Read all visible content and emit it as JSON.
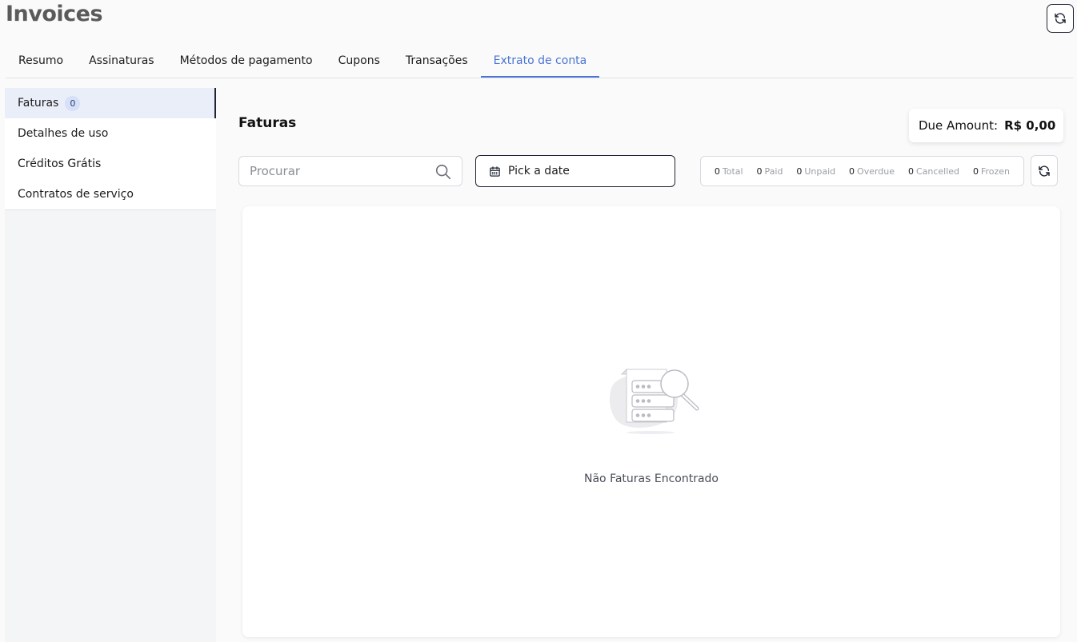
{
  "page": {
    "title": "Invoices"
  },
  "tabs": [
    {
      "label": "Resumo"
    },
    {
      "label": "Assinaturas"
    },
    {
      "label": "Métodos de pagamento"
    },
    {
      "label": "Cupons"
    },
    {
      "label": "Transações"
    },
    {
      "label": "Extrato de conta"
    }
  ],
  "sidebar": {
    "items": [
      {
        "label": "Faturas",
        "badge": "0"
      },
      {
        "label": "Detalhes de uso"
      },
      {
        "label": "Créditos Grátis"
      },
      {
        "label": "Contratos de serviço"
      }
    ]
  },
  "main": {
    "title": "Faturas",
    "due": {
      "label": "Due Amount:",
      "value": "R$ 0,00"
    },
    "search": {
      "placeholder": "Procurar",
      "value": ""
    },
    "date_picker": {
      "label": "Pick a date"
    },
    "status": [
      {
        "count": "0",
        "label": "Total"
      },
      {
        "count": "0",
        "label": "Paid"
      },
      {
        "count": "0",
        "label": "Unpaid"
      },
      {
        "count": "0",
        "label": "Overdue"
      },
      {
        "count": "0",
        "label": "Cancelled"
      },
      {
        "count": "0",
        "label": "Frozen"
      }
    ],
    "empty_message": "Não Faturas Encontrado"
  },
  "colors": {
    "accent": "#4b74d6",
    "dark": "#1f2533",
    "active_bg": "#eaeef9"
  },
  "icons": [
    "refresh-icon",
    "search-icon",
    "calendar-icon",
    "empty-state-icon"
  ]
}
